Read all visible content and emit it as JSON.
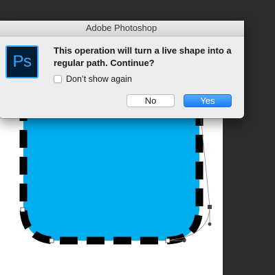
{
  "dialog": {
    "title": "Adobe Photoshop",
    "app_icon_text": "Ps",
    "message": "This operation will turn a live shape into a regular path. Continue?",
    "checkbox_label": "Don’t show again",
    "checkbox_checked": false,
    "no_label": "No",
    "yes_label": "Yes"
  },
  "colors": {
    "workspace": "#2b2b2b",
    "document": "#ffffff",
    "shape_fill": "#00aeef",
    "shape_stroke": "#000000",
    "default_button": "#1a80f5",
    "ps_icon_bg": "#001e36",
    "ps_icon_accent": "#31a8ff"
  },
  "icons": {
    "app": "photoshop-icon"
  }
}
